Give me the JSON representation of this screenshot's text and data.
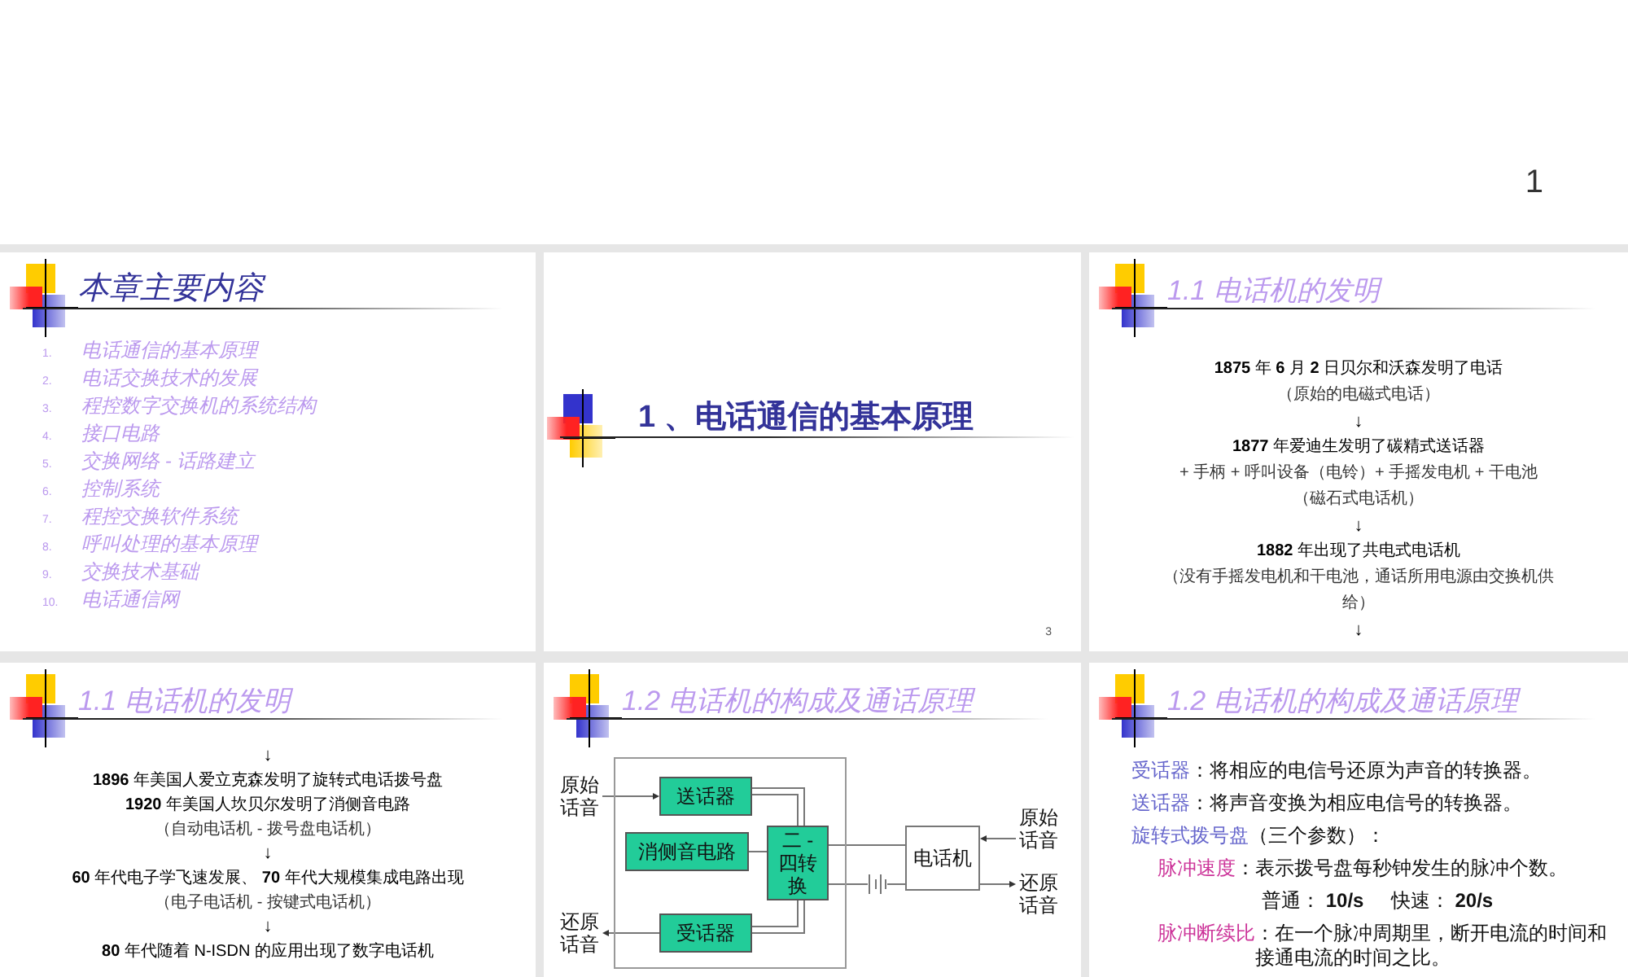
{
  "page_number": "1",
  "slides": [
    {
      "kind": "toc",
      "title": "本章主要内容",
      "items": [
        {
          "number": "1.",
          "text": "电话通信的基本原理"
        },
        {
          "number": "2.",
          "text": "电话交换技术的发展"
        },
        {
          "number": "3.",
          "text": "程控数字交换机的系统结构"
        },
        {
          "number": "4.",
          "text": "接口电路"
        },
        {
          "number": "5.",
          "text": "交换网络 - 话路建立"
        },
        {
          "number": "6.",
          "text": "控制系统"
        },
        {
          "number": "7.",
          "text": "程控交换软件系统"
        },
        {
          "number": "8.",
          "text": "呼叫处理的基本原理"
        },
        {
          "number": "9.",
          "text": "交换技术基础"
        },
        {
          "number": "10.",
          "text": "电话通信网"
        }
      ]
    },
    {
      "kind": "section",
      "title": "1 、电话通信的基本原理",
      "slide_number": "3"
    },
    {
      "kind": "flow",
      "title": "1.1   电话机的发明",
      "lines": [
        {
          "kind": "event",
          "text": "**1875** 年 **6** 月 **2** 日贝尔和沃森发明了电话"
        },
        {
          "kind": "note",
          "text": "（原始的电磁式电话）"
        },
        {
          "kind": "arrow",
          "text": "↓"
        },
        {
          "kind": "event",
          "text": "**1877** 年爱迪生发明了碳精式送话器"
        },
        {
          "kind": "note",
          "text": "+ 手柄 + 呼叫设备（电铃）+ 手摇发电机 + 干电池"
        },
        {
          "kind": "note",
          "text": "（磁石式电话机）"
        },
        {
          "kind": "arrow",
          "text": "↓"
        },
        {
          "kind": "event",
          "text": "**1882** 年出现了共电式电话机"
        },
        {
          "kind": "note",
          "text": "（没有手摇发电机和干电池，通话所用电源由交换机供给）"
        },
        {
          "kind": "arrow",
          "text": "↓"
        }
      ]
    },
    {
      "kind": "flow",
      "title": "1.1   电话机的发明",
      "lines": [
        {
          "kind": "arrow",
          "text": "↓"
        },
        {
          "kind": "event",
          "text": "**1896** 年美国人爱立克森发明了旋转式电话拨号盘"
        },
        {
          "kind": "event",
          "text": "**1920** 年美国人坎贝尔发明了消侧音电路"
        },
        {
          "kind": "note",
          "text": "（自动电话机 - 拨号盘电话机）"
        },
        {
          "kind": "arrow",
          "text": "↓"
        },
        {
          "kind": "event",
          "text": "**60** 年代电子学飞速发展、 **70** 年代大规模集成电路出现"
        },
        {
          "kind": "note",
          "text": "（电子电话机 - 按键式电话机）"
        },
        {
          "kind": "arrow",
          "text": "↓"
        },
        {
          "kind": "event",
          "text": "**80** 年代随着 N-ISDN 的应用出现了数字电话机"
        }
      ]
    },
    {
      "kind": "diagram",
      "title": "1.2   电话机的构成及通话原理",
      "diagram": {
        "input_label": "原始话音",
        "output_label": "还原话音",
        "transmitter": "送话器",
        "sidetone": "消侧音电路",
        "receiver": "受话器",
        "hybrid": "二 - 四转换",
        "telephone": "电话机",
        "remote_input_label": "原始话音",
        "remote_output_label": "还原话音"
      }
    },
    {
      "kind": "definitions",
      "title": "1.2   电话机的构成及通话原理",
      "items": [
        {
          "kind": "definition",
          "term": "受话器",
          "color": "#6666cc",
          "text": "：将相应的电信号还原为声音的转换器。"
        },
        {
          "kind": "definition",
          "term": "送话器",
          "color": "#6666cc",
          "text": "：将声音变换为相应电信号的转换器。"
        },
        {
          "kind": "definition",
          "term": "旋转式拨号盘",
          "color": "#6666cc",
          "text": "（三个参数）：",
          "children": [
            {
              "kind": "definition",
              "term": "脉冲速度",
              "color": "#cc3399",
              "text": "：表示拨号盘每秒钟发生的脉冲个数。"
            },
            {
              "kind": "values",
              "text": "普通： **10/s**     快速： **20/s**"
            },
            {
              "kind": "definition",
              "term": "脉冲断续比",
              "color": "#cc3399",
              "text": "：在一个脉冲周期里，断开电流的时间和接通电流的时间之比。"
            }
          ]
        }
      ]
    }
  ]
}
